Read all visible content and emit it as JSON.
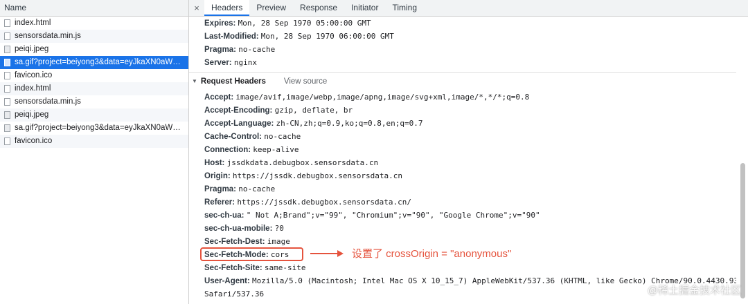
{
  "left_panel": {
    "header": "Name",
    "files": [
      {
        "name": "index.html",
        "kind": "doc"
      },
      {
        "name": "sensorsdata.min.js",
        "kind": "doc"
      },
      {
        "name": "peiqi.jpeg",
        "kind": "img"
      },
      {
        "name": "sa.gif?project=beiyong3&data=eyJkaXN0aW5jdF9pZCI6IjE3OGQ...",
        "kind": "img",
        "selected": true
      },
      {
        "name": "favicon.ico",
        "kind": "doc"
      },
      {
        "name": "index.html",
        "kind": "doc"
      },
      {
        "name": "sensorsdata.min.js",
        "kind": "doc"
      },
      {
        "name": "peiqi.jpeg",
        "kind": "img"
      },
      {
        "name": "sa.gif?project=beiyong3&data=eyJkaXN0aW5jdF9pZCI6IjE3OGQ...",
        "kind": "img"
      },
      {
        "name": "favicon.ico",
        "kind": "doc"
      }
    ]
  },
  "tabs": {
    "close_symbol": "×",
    "items": [
      "Headers",
      "Preview",
      "Response",
      "Initiator",
      "Timing"
    ],
    "active": "Headers"
  },
  "response_headers": [
    {
      "key": "Expires:",
      "value": "Mon, 28 Sep 1970 05:00:00 GMT"
    },
    {
      "key": "Last-Modified:",
      "value": "Mon, 28 Sep 1970 06:00:00 GMT"
    },
    {
      "key": "Pragma:",
      "value": "no-cache"
    },
    {
      "key": "Server:",
      "value": "nginx"
    }
  ],
  "request_section": {
    "title": "Request Headers",
    "view_source": "View source",
    "triangle": "▼"
  },
  "request_headers": [
    {
      "key": "Accept:",
      "value": "image/avif,image/webp,image/apng,image/svg+xml,image/*,*/*;q=0.8"
    },
    {
      "key": "Accept-Encoding:",
      "value": "gzip, deflate, br"
    },
    {
      "key": "Accept-Language:",
      "value": "zh-CN,zh;q=0.9,ko;q=0.8,en;q=0.7"
    },
    {
      "key": "Cache-Control:",
      "value": "no-cache"
    },
    {
      "key": "Connection:",
      "value": "keep-alive"
    },
    {
      "key": "Host:",
      "value": "jssdkdata.debugbox.sensorsdata.cn"
    },
    {
      "key": "Origin:",
      "value": "https://jssdk.debugbox.sensorsdata.cn"
    },
    {
      "key": "Pragma:",
      "value": "no-cache"
    },
    {
      "key": "Referer:",
      "value": "https://jssdk.debugbox.sensorsdata.cn/"
    },
    {
      "key": "sec-ch-ua:",
      "value": "\" Not A;Brand\";v=\"99\", \"Chromium\";v=\"90\", \"Google Chrome\";v=\"90\""
    },
    {
      "key": "sec-ch-ua-mobile:",
      "value": "?0"
    },
    {
      "key": "Sec-Fetch-Dest:",
      "value": "image"
    },
    {
      "key": "Sec-Fetch-Mode:",
      "value": "cors"
    },
    {
      "key": "Sec-Fetch-Site:",
      "value": "same-site"
    },
    {
      "key": "User-Agent:",
      "value": "Mozilla/5.0 (Macintosh; Intel Mac OS X 10_15_7) AppleWebKit/537.36 (KHTML, like Gecko) Chrome/90.0.4430.93"
    },
    {
      "key": "",
      "value": "Safari/537.36"
    }
  ],
  "annotation": {
    "text": "设置了 crossOrigin = \"anonymous\"",
    "color": "#e5533d"
  },
  "watermark": "@稀土掘金技术社区",
  "colors": {
    "selected_row": "#1a73e8",
    "tab_underline": "#1a73e8",
    "annotation": "#e5533d"
  }
}
